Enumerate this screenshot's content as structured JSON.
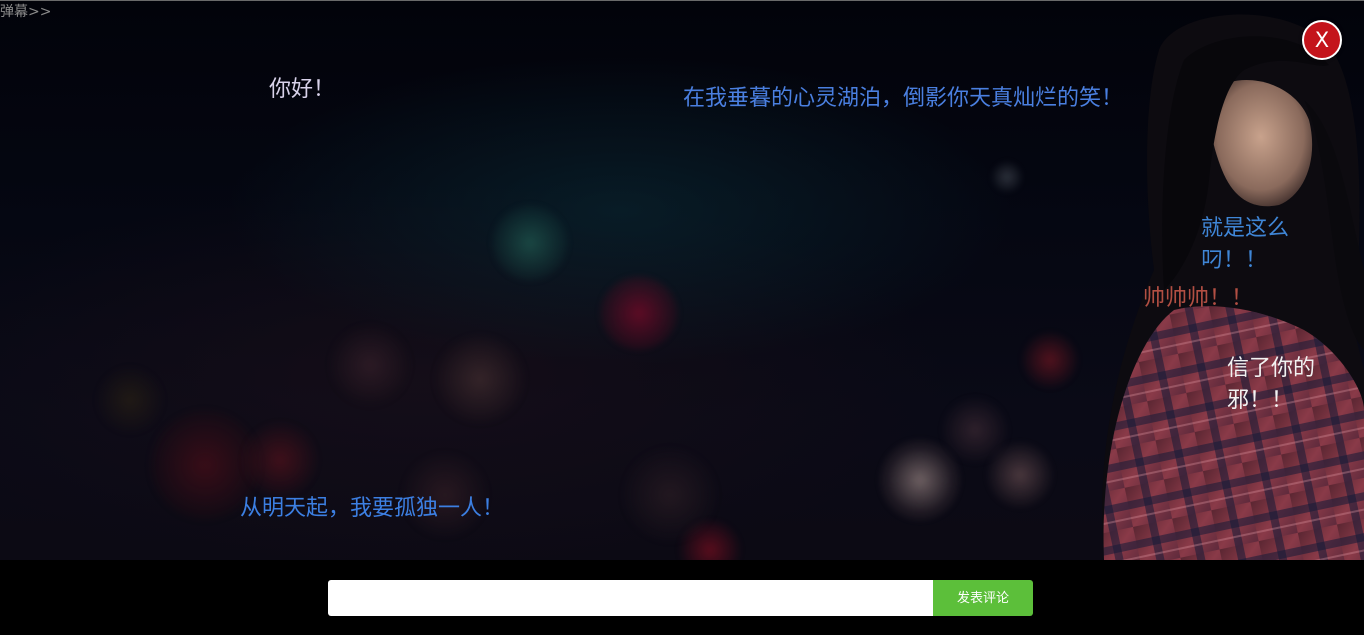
{
  "header": {
    "toggle_label": "弹幕>>"
  },
  "close_button": {
    "label": "X",
    "color": "#c4141b"
  },
  "background": {
    "description_icon": "night-bokeh-photo"
  },
  "danmaku": [
    {
      "text": "你好！",
      "color": "#d8d2ea"
    },
    {
      "text": "在我垂暮的心灵湖泊，倒影你天真灿烂的笑！",
      "color": "#4a7fe0"
    },
    {
      "text": "就是这么叼！！",
      "color": "#3f86d6"
    },
    {
      "text": "帅帅帅！！",
      "color": "#b24f43"
    },
    {
      "text": "信了你的邪！！",
      "color": "#f2f2f2"
    },
    {
      "text": "从明天起，我要孤独一人！",
      "color": "#3c7fe2"
    }
  ],
  "comment_form": {
    "input_value": "",
    "input_placeholder": "",
    "submit_label": "发表评论",
    "submit_color": "#5cbf3a"
  }
}
